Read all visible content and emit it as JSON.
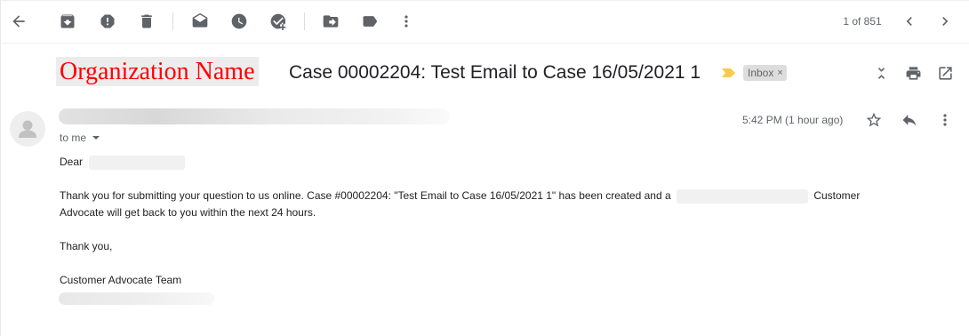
{
  "toolbar": {
    "back": "back-arrow-icon",
    "archive": "archive-icon",
    "report_spam": "report-spam-icon",
    "delete": "trash-icon",
    "mark_unread": "mark-unread-icon",
    "snooze": "clock-icon",
    "add_task": "add-task-icon",
    "move_to": "move-to-icon",
    "labels": "label-icon",
    "more": "more-vert-icon",
    "pager": "1 of 851",
    "prev": "chevron-left-icon",
    "next": "chevron-right-icon"
  },
  "message": {
    "org_label": "Organization Name",
    "subject": "Case 00002204: Test Email to Case 16/05/2021 1",
    "label_chip": "Inbox",
    "label_chip_close": "×",
    "recipient": "to me",
    "timestamp": "5:42 PM (1 hour ago)"
  },
  "body": {
    "greeting": "Dear",
    "para1_a": "Thank you for submitting your question to us online.  Case #00002204: \"Test Email to Case 16/05/2021 1\" has been created and a",
    "para1_b": "Customer",
    "para1_c": "Advocate will get back to you within the next 24 hours.",
    "thanks": "Thank you,",
    "signature": "Customer Advocate Team"
  },
  "colors": {
    "org_label_text": "#ff0000",
    "important_marker": "#f7cb4d",
    "icon": "#5f6368"
  }
}
